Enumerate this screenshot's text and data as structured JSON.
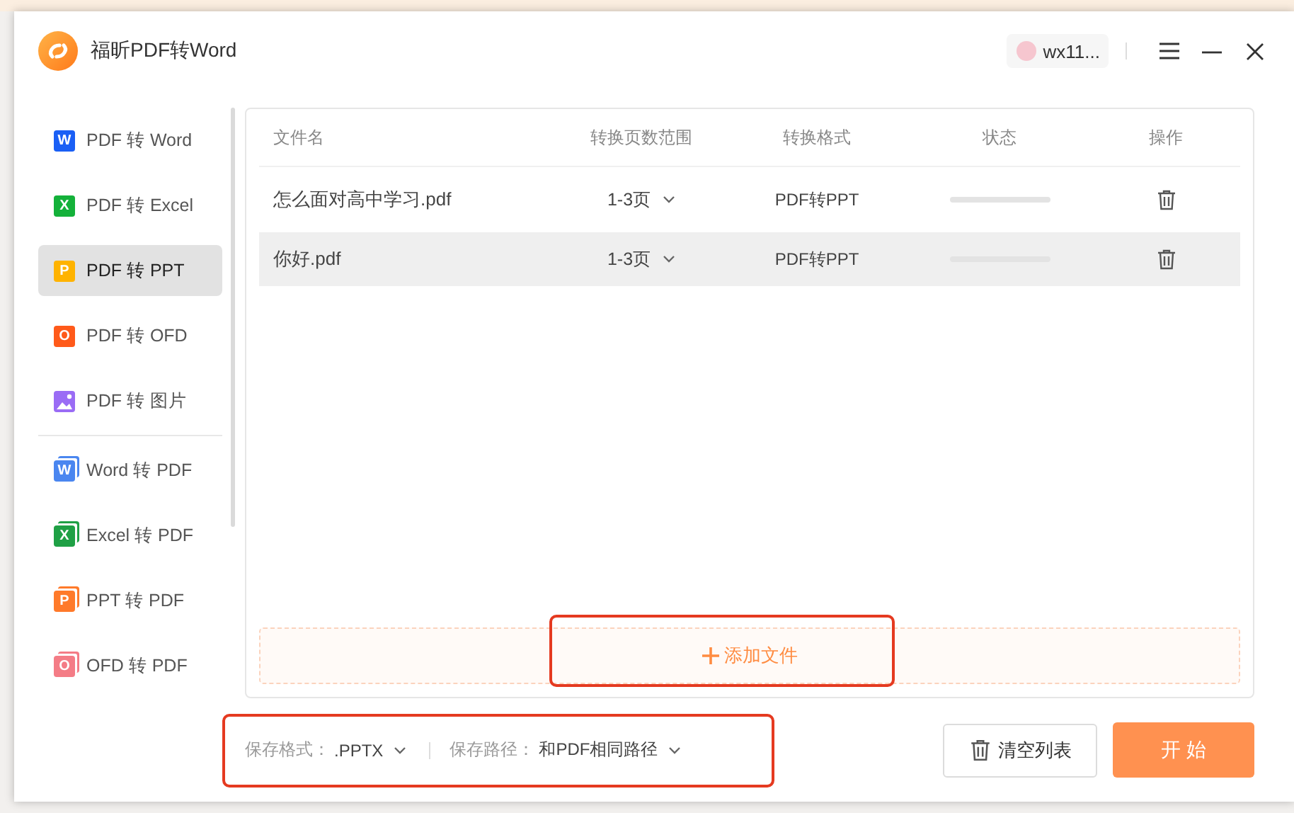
{
  "window": {
    "title": "福昕PDF转Word",
    "user": "wx11..."
  },
  "sidebar": {
    "items": [
      {
        "label": "PDF 转 Word",
        "badge": "W",
        "kind": "from-pdf",
        "color": "#1a5ff5",
        "selected": false
      },
      {
        "label": "PDF 转 Excel",
        "badge": "X",
        "kind": "from-pdf",
        "color": "#14b13a",
        "selected": false
      },
      {
        "label": "PDF 转 PPT",
        "badge": "P",
        "kind": "from-pdf",
        "color": "#ffb300",
        "selected": true
      },
      {
        "label": "PDF 转 OFD",
        "badge": "O",
        "kind": "from-pdf",
        "color": "#ff5a1a",
        "selected": false
      },
      {
        "label": "PDF 转 图片",
        "kind": "image",
        "color": "#9a6cf5",
        "selected": false
      },
      {
        "label": "Word 转 PDF",
        "badge": "W",
        "kind": "to-pdf",
        "color": "#4a86f0",
        "selected": false
      },
      {
        "label": "Excel 转 PDF",
        "badge": "X",
        "kind": "to-pdf",
        "color": "#1fa045",
        "selected": false
      },
      {
        "label": "PPT 转 PDF",
        "badge": "P",
        "kind": "to-pdf",
        "color": "#ff7a2a",
        "selected": false
      },
      {
        "label": "OFD 转 PDF",
        "badge": "O",
        "kind": "to-pdf",
        "color": "#f47c86",
        "selected": false
      }
    ]
  },
  "table": {
    "columns": [
      "文件名",
      "转换页数范围",
      "转换格式",
      "状态",
      "操作"
    ],
    "rows": [
      {
        "file": "怎么面对高中学习.pdf",
        "range": "1-3页",
        "format": "PDF转PPT",
        "level": 0,
        "selected": false
      },
      {
        "file": "你好.pdf",
        "range": "1-3页",
        "format": "PDF转PPT",
        "level": 0,
        "selected": true
      }
    ]
  },
  "add_file": {
    "label": "添加文件",
    "highlighted": true
  },
  "footer": {
    "highlighted": true,
    "format_label": "保存格式：",
    "format_value": ".PPTX",
    "path_label": "保存路径：",
    "path_value": "和PDF相同路径",
    "clear_button": "清空列表",
    "start_button": "开 始"
  }
}
